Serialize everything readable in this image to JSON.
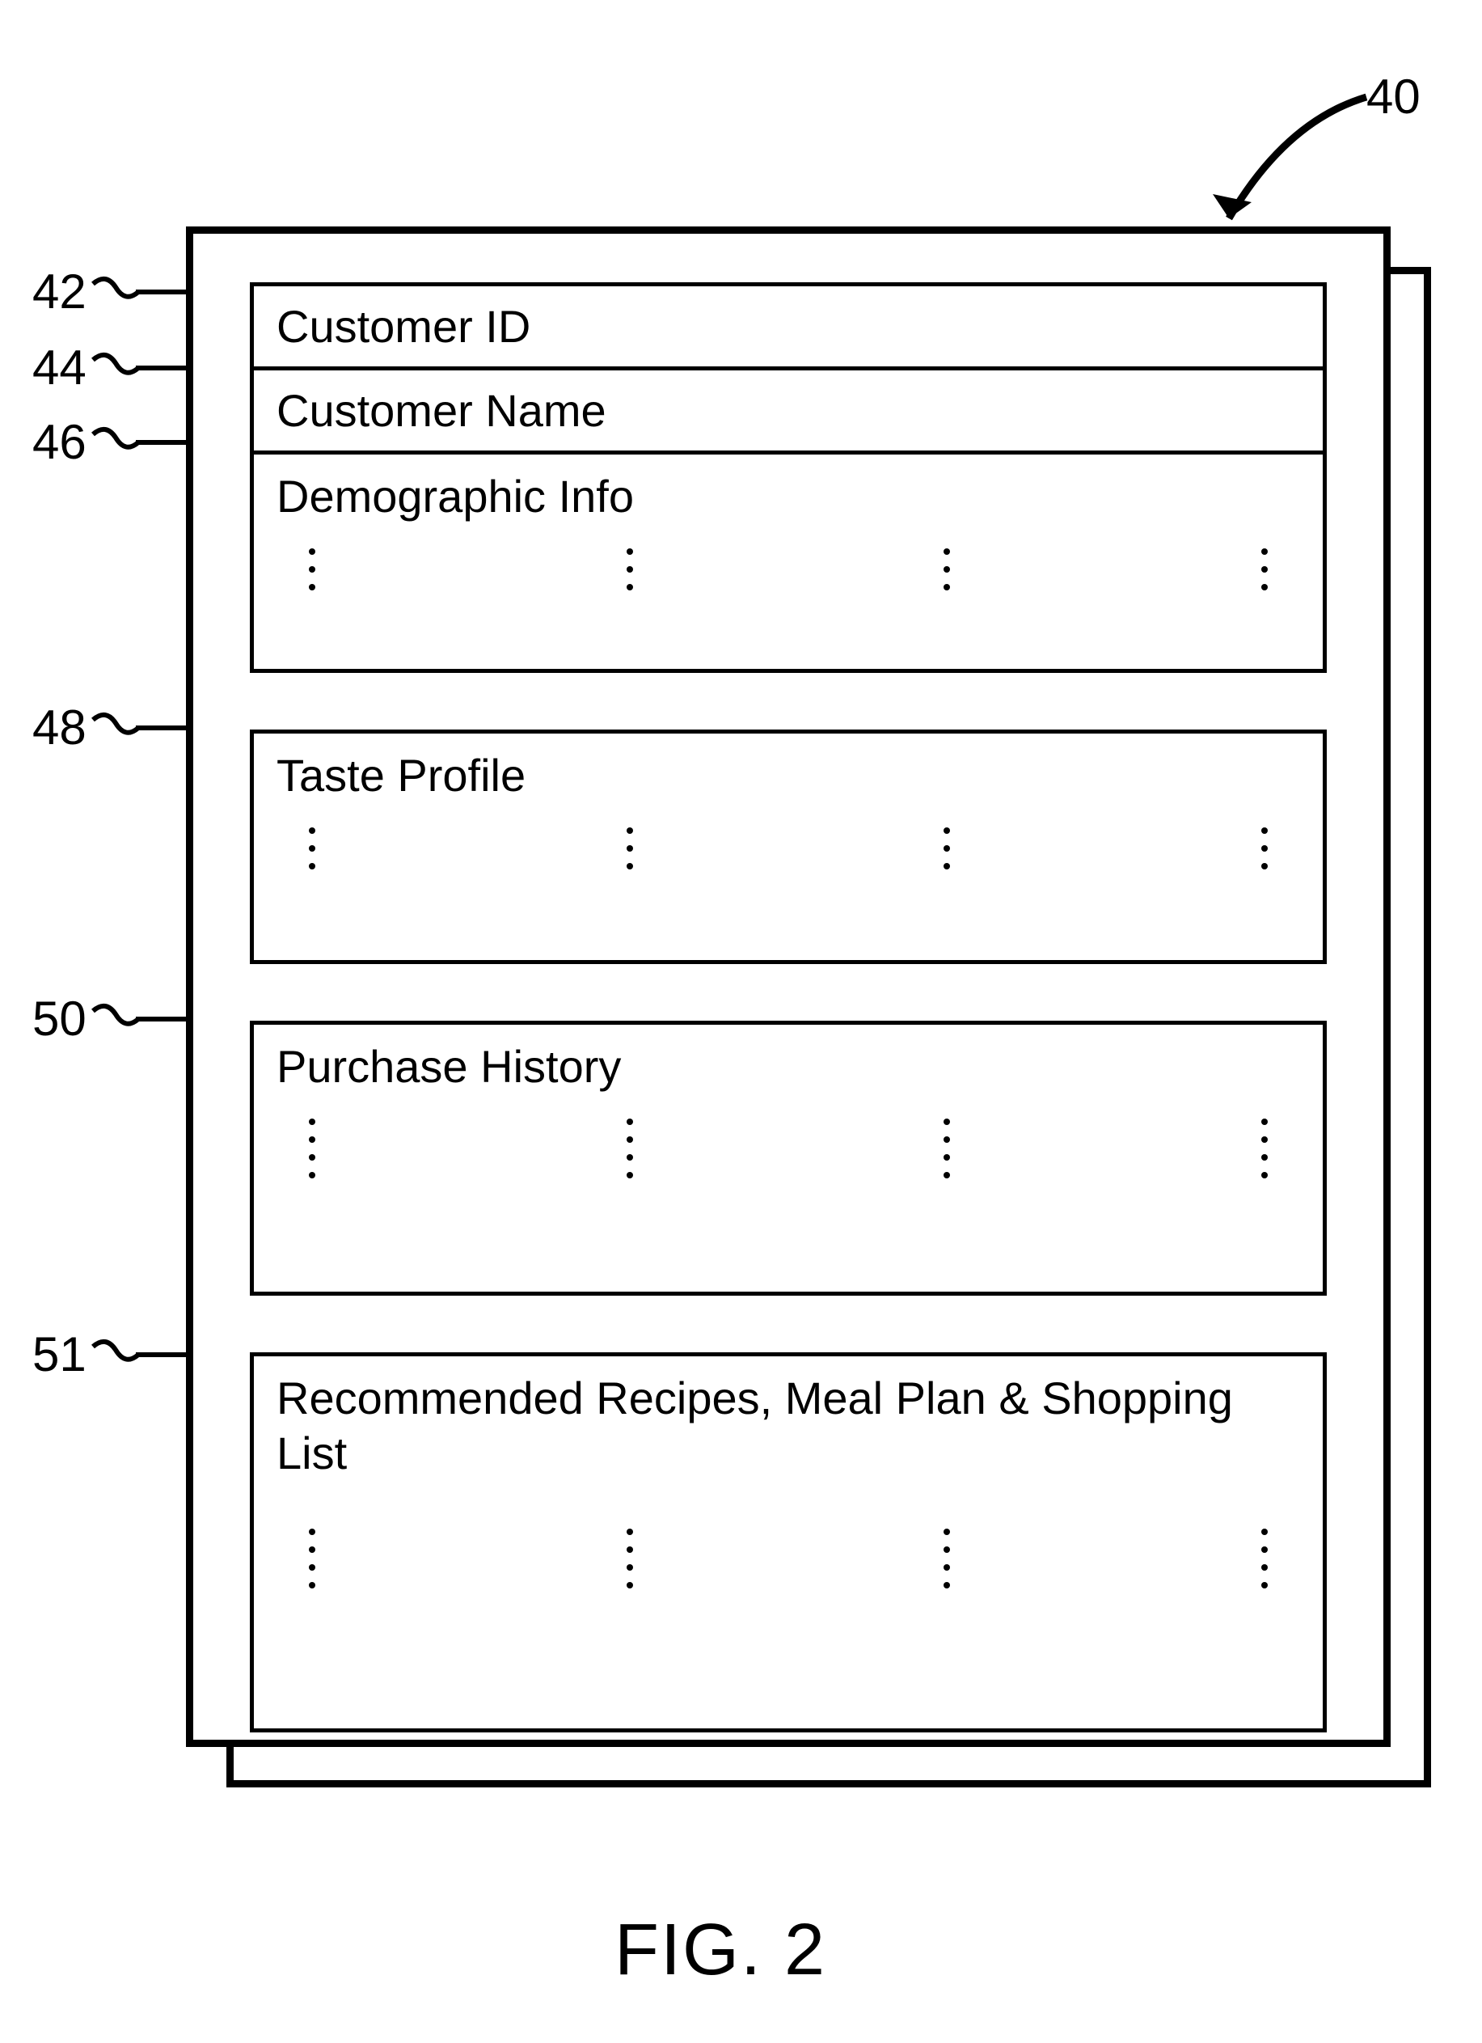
{
  "refs": {
    "r40": "40",
    "r42": "42",
    "r44": "44",
    "r46": "46",
    "r48": "48",
    "r50": "50",
    "r51": "51"
  },
  "slots": {
    "s1": "Customer ID",
    "s2": "Customer Name",
    "s3": "Demographic Info",
    "s4": "Taste Profile",
    "s5": "Purchase History",
    "s6": "Recommended Recipes, Meal Plan & Shopping List"
  },
  "caption": "FIG. 2"
}
